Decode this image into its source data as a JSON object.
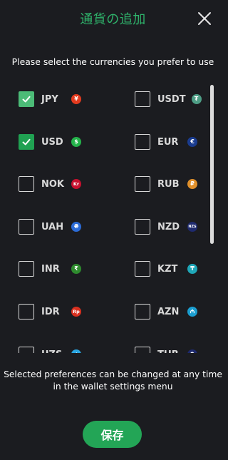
{
  "header": {
    "title": "通貨の追加"
  },
  "instructions": "Please select the currencies you prefer to use",
  "currencies": [
    {
      "code": "JPY",
      "checked": true,
      "icon_name": "yen-icon",
      "symbol": "¥",
      "color": "#e33b1f"
    },
    {
      "code": "USDT",
      "checked": false,
      "icon_name": "tether-icon",
      "symbol": "₮",
      "color": "#4e9e86"
    },
    {
      "code": "USD",
      "checked": true,
      "icon_name": "dollar-icon",
      "symbol": "$",
      "color": "#24b24a"
    },
    {
      "code": "EUR",
      "checked": false,
      "icon_name": "euro-icon",
      "symbol": "€",
      "color": "#1a3c8f"
    },
    {
      "code": "NOK",
      "checked": false,
      "icon_name": "krone-icon",
      "symbol": "Kr",
      "color": "#c8102e"
    },
    {
      "code": "RUB",
      "checked": false,
      "icon_name": "ruble-icon",
      "symbol": "₽",
      "color": "#e0902b"
    },
    {
      "code": "UAH",
      "checked": false,
      "icon_name": "hryvnia-icon",
      "symbol": "₴",
      "color": "#2b6bd6"
    },
    {
      "code": "NZD",
      "checked": false,
      "icon_name": "nzd-icon",
      "symbol": "NZ$",
      "color": "#1e2a6e"
    },
    {
      "code": "INR",
      "checked": false,
      "icon_name": "rupee-icon",
      "symbol": "₹",
      "color": "#2e8b2e"
    },
    {
      "code": "KZT",
      "checked": false,
      "icon_name": "tenge-icon",
      "symbol": "₸",
      "color": "#1fa7b8"
    },
    {
      "code": "IDR",
      "checked": false,
      "icon_name": "rupiah-icon",
      "symbol": "Rp",
      "color": "#d9301f"
    },
    {
      "code": "AZN",
      "checked": false,
      "icon_name": "manat-icon",
      "symbol": "₼",
      "color": "#1b9ed0"
    },
    {
      "code": "UZS",
      "checked": false,
      "icon_name": "som-icon",
      "symbol": "so'm",
      "color": "#2aa5e0"
    },
    {
      "code": "THB",
      "checked": false,
      "icon_name": "baht-icon",
      "symbol": "฿",
      "color": "#1e2a6e"
    }
  ],
  "footer_note": "Selected preferences can be changed at any time in the wallet settings menu",
  "save_label": "保存",
  "colors": {
    "accent": "#23a556",
    "title": "#2fb36b",
    "background": "#1b1c20"
  }
}
